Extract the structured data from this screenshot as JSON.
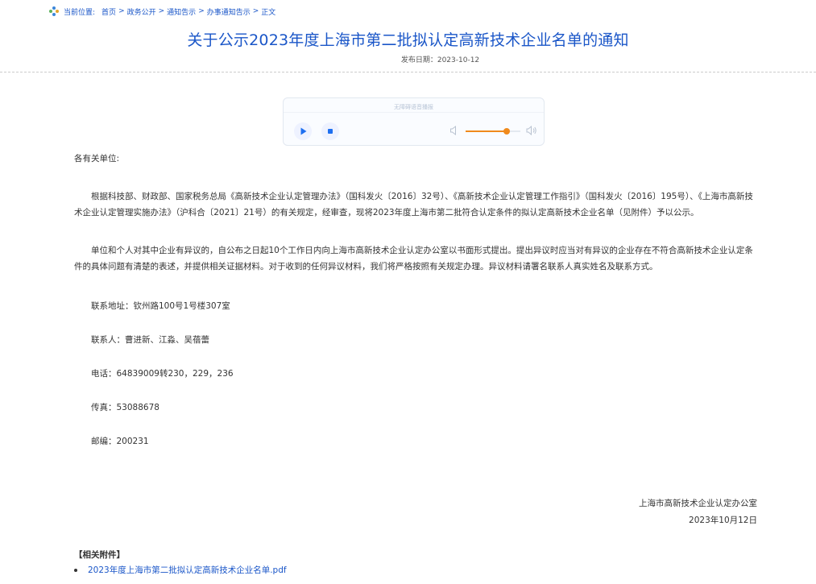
{
  "breadcrumb": {
    "label": "当前位置:",
    "items": [
      "首页",
      "政务公开",
      "通知告示",
      "办事通知告示",
      "正文"
    ],
    "separator": ">"
  },
  "article": {
    "title": "关于公示2023年度上海市第二批拟认定高新技术企业名单的通知",
    "publish_date": "发布日期：2023-10-12"
  },
  "player": {
    "caption": "无障碍语音播报",
    "volume_percent": 75,
    "accent_color": "#f08a1c",
    "button_color": "#1e6ff0"
  },
  "body": {
    "salutation": "各有关单位:",
    "paragraphs": [
      "根据科技部、财政部、国家税务总局《高新技术企业认定管理办法》（国科发火〔2016〕32号）、《高新技术企业认定管理工作指引》（国科发火〔2016〕195号）、《上海市高新技术企业认定管理实施办法》（沪科合〔2021〕21号）的有关规定，经审查，现将2023年度上海市第二批符合认定条件的拟认定高新技术企业名单（见附件）予以公示。",
      "单位和个人对其中企业有异议的，自公布之日起10个工作日内向上海市高新技术企业认定办公室以书面形式提出。提出异议时应当对有异议的企业存在不符合高新技术企业认定条件的具体问题有清楚的表述，并提供相关证据材料。对于收到的任何异议材料，我们将严格按照有关规定办理。异议材料请署名联系人真实姓名及联系方式。"
    ],
    "contacts": [
      "联系地址：钦州路100号1号楼307室",
      "联系人：曹进新、江淼、吴蓓蕾",
      "电话：64839009转230，229，236",
      "传真：53088678",
      "邮编：200231"
    ]
  },
  "signature": {
    "org": "上海市高新技术企业认定办公室",
    "date": "2023年10月12日"
  },
  "attachments": {
    "title": "【相关附件】",
    "items": [
      "2023年度上海市第二批拟认定高新技术企业名单.pdf"
    ]
  }
}
